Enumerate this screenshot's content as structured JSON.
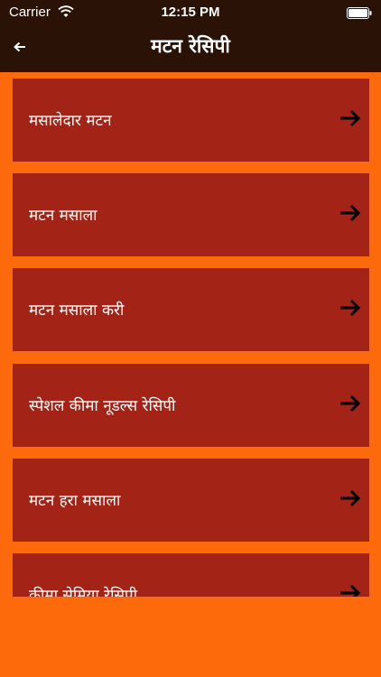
{
  "status_bar": {
    "carrier": "Carrier",
    "time": "12:15 PM",
    "wifi_icon": "wifi-icon",
    "battery_icon": "battery-icon"
  },
  "nav": {
    "title": "मटन रेसिपी",
    "back_icon": "back-arrow-icon"
  },
  "colors": {
    "header_bg": "#2a1206",
    "page_bg": "#fd6a0c",
    "item_bg": "#a32416",
    "text": "#ffffff",
    "arrow": "#000000"
  },
  "recipes": {
    "items": [
      {
        "label": "मसालेदार मटन",
        "icon": "arrow-right-icon"
      },
      {
        "label": "मटन मसाला",
        "icon": "arrow-right-icon"
      },
      {
        "label": "मटन मसाला करी",
        "icon": "arrow-right-icon"
      },
      {
        "label": "स्पेशल कीमा नूडल्स रेसिपी",
        "icon": "arrow-right-icon"
      },
      {
        "label": "मटन हरा मसाला",
        "icon": "arrow-right-icon"
      },
      {
        "label": "कीमा सेमिया रेसिपी",
        "icon": "arrow-right-icon"
      }
    ]
  }
}
